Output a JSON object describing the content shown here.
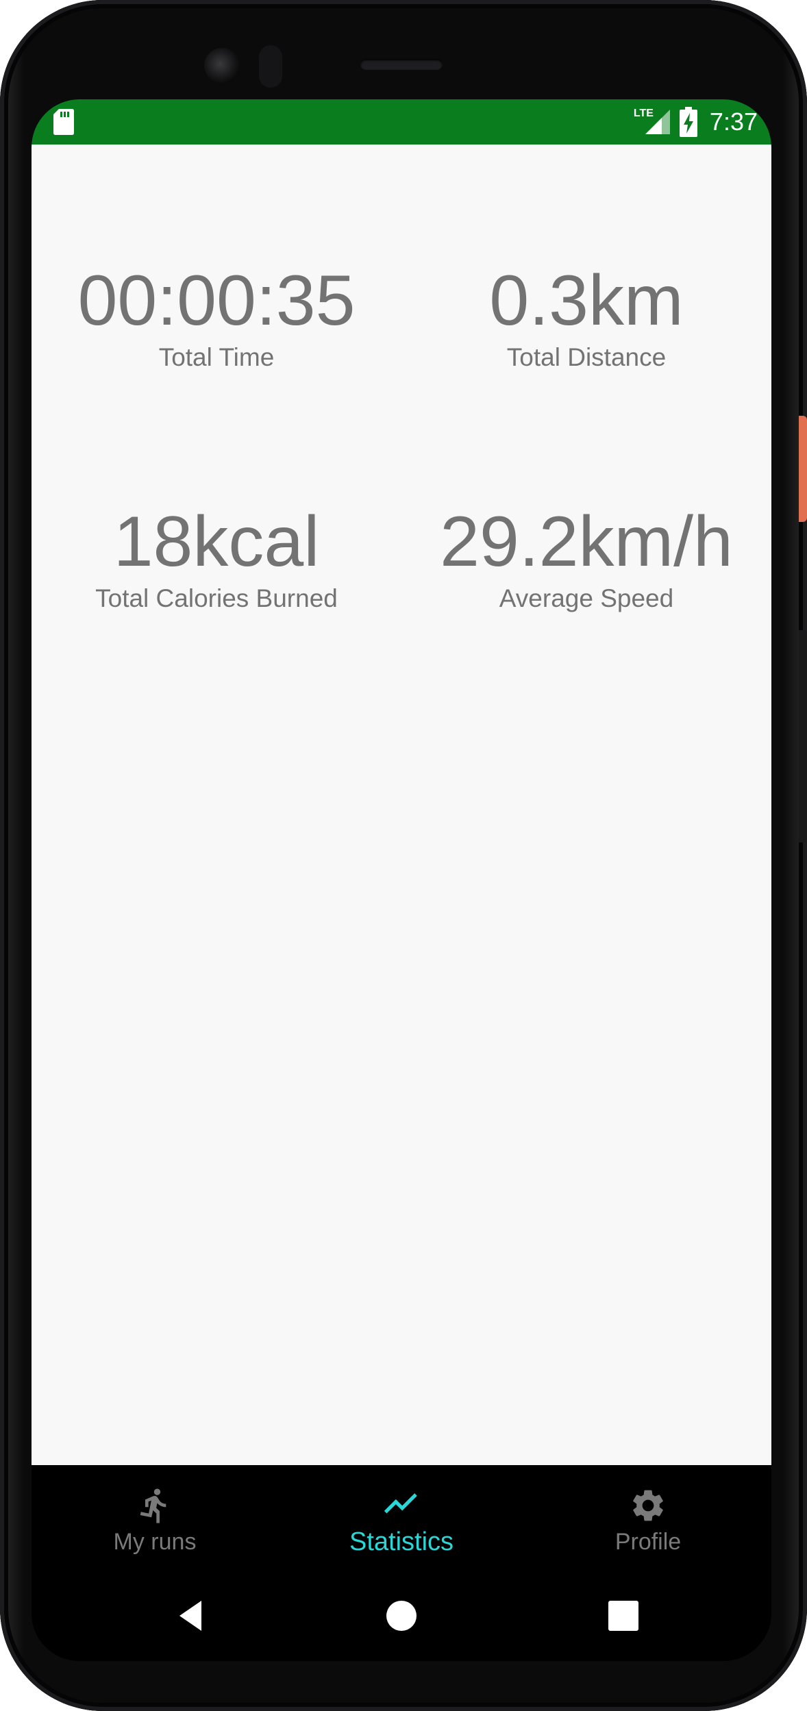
{
  "status_bar": {
    "network": "LTE",
    "time": "7:37"
  },
  "stats": [
    {
      "value": "00:00:35",
      "label": "Total Time"
    },
    {
      "value": "0.3km",
      "label": "Total Distance"
    },
    {
      "value": "18kcal",
      "label": "Total Calories Burned"
    },
    {
      "value": "29.2km/h",
      "label": "Average Speed"
    }
  ],
  "bottom_nav": {
    "items": [
      {
        "label": "My runs",
        "icon": "running-person-icon",
        "active": false
      },
      {
        "label": "Statistics",
        "icon": "trending-up-icon",
        "active": true
      },
      {
        "label": "Profile",
        "icon": "gear-icon",
        "active": false
      }
    ]
  },
  "colors": {
    "status_bar": "#0a7d1f",
    "active_nav": "#2ad6d6",
    "inactive_nav": "#7a7a7a",
    "stat_text": "#737373",
    "content_bg": "#f8f8f8"
  }
}
